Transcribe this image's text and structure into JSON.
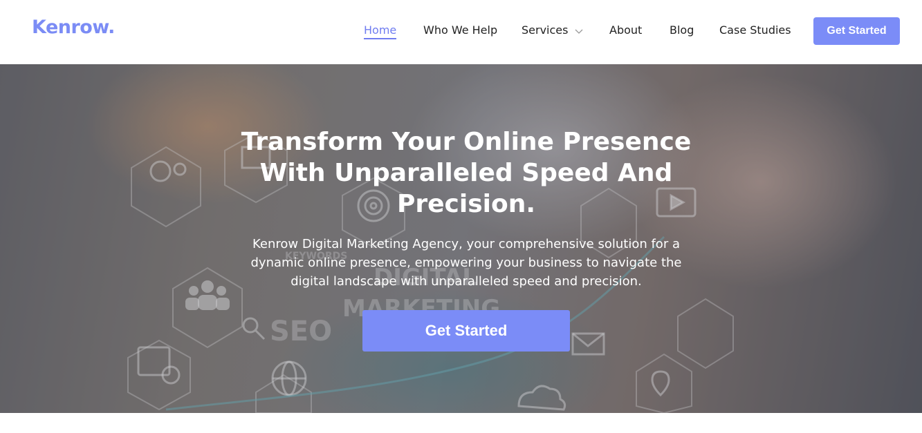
{
  "brand": {
    "logo": "Kenrow.",
    "accent": "#7b8cf7"
  },
  "nav": {
    "items": [
      {
        "label": "Home",
        "active": true
      },
      {
        "label": "Who We Help"
      },
      {
        "label": "Services",
        "has_dropdown": true
      },
      {
        "label": "About"
      },
      {
        "label": "Blog"
      },
      {
        "label": "Case Studies"
      }
    ],
    "cta": "Get Started"
  },
  "hero": {
    "title": "Transform Your Online Presence With Unparalleled Speed And Precision.",
    "subtitle": "Kenrow Digital Marketing Agency, your comprehensive solution for a dynamic online presence, empowering your business to navigate the digital landscape with unparalleled speed and precision.",
    "cta": "Get Started",
    "background_text": {
      "seo": "SEO",
      "keywords": "KEYWORDS",
      "digital": "DIGITAL",
      "marketing": "MARKETING"
    }
  }
}
